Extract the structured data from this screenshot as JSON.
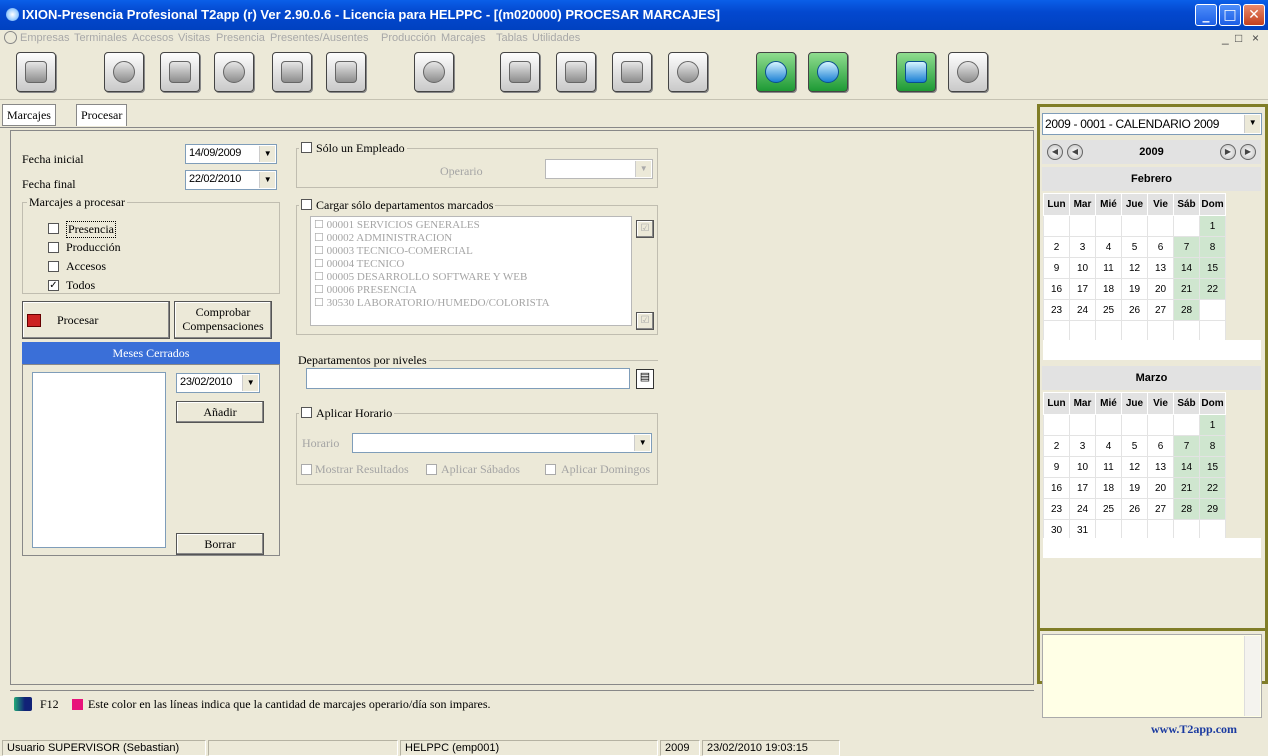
{
  "window": {
    "title": "IXION-Presencia Profesional T2app (r) Ver 2.90.0.6  -  Licencia para HELPPC - [(m020000)  PROCESAR MARCAJES]",
    "min": "_",
    "max": "□",
    "close": "✕"
  },
  "menu": {
    "items": [
      "Empresas",
      "Terminales",
      "Accesos",
      "Visitas",
      "Presencia",
      "Presentes/Ausentes",
      "Producción",
      "Marcajes",
      "Tablas",
      "Utilidades"
    ],
    "mdi_min": "_",
    "mdi_max": "□",
    "mdi_close": "×"
  },
  "toolbar": {
    "icons": [
      "users-icon",
      "disk-icon",
      "tools-icon",
      "gear-icon",
      "monitor-icon",
      "printer-icon",
      "help-icon",
      "clipboard-icon",
      "person-icon",
      "calendar-icon",
      "check-icon",
      "refresh-icon",
      "info-icon",
      "calculator-icon",
      "power-icon"
    ]
  },
  "tabs": {
    "marcajes": "Marcajes",
    "procesar": "Procesar"
  },
  "form": {
    "fecha_inicial_label": "Fecha inicial",
    "fecha_inicial": "14/09/2009",
    "fecha_final_label": "Fecha final",
    "fecha_final": "22/02/2010",
    "marcajes_group": "Marcajes a procesar",
    "presencia": "Presencia",
    "produccion": "Producción",
    "accesos": "Accesos",
    "todos": "Todos",
    "todos_checked": "✓",
    "procesar_btn": "Procesar",
    "comprobar_btn_1": "Comprobar",
    "comprobar_btn_2": "Compensaciones",
    "meses_cerrados": "Meses Cerrados",
    "mes_date": "23/02/2010",
    "anadir_btn": "Añadir",
    "borrar_btn": "Borrar",
    "solo_empleado": "Sólo un Empleado",
    "operario_label": "Operario",
    "cargar_deptos": "Cargar sólo departamentos marcados",
    "departamentos": [
      "00001 SERVICIOS GENERALES",
      "00002 ADMINISTRACION",
      "00003 TECNICO-COMERCIAL",
      "00004 TECNICO",
      "00005 DESARROLLO SOFTWARE Y WEB",
      "00006 PRESENCIA",
      "30530 LABORATORIO/HUMEDO/COLORISTA"
    ],
    "deptos_niveles": "Departamentos por niveles",
    "aplicar_horario": "Aplicar Horario",
    "horario_label": "Horario",
    "mostrar_resultados": "Mostrar Resultados",
    "aplicar_sabados": "Aplicar Sábados",
    "aplicar_domingos": "Aplicar Domingos"
  },
  "footer": {
    "f12": "F12",
    "note": "Este color en las líneas indica que la cantidad de marcajes operario/día son impares.",
    "odd_color": "#e8127a",
    "site": "www.T2app.com"
  },
  "calendar": {
    "selector": "2009 - 0001 - CALENDARIO 2009",
    "year": "2009",
    "weekdays": [
      "Lun",
      "Mar",
      "Mié",
      "Jue",
      "Vie",
      "Sáb",
      "Dom"
    ],
    "months": [
      {
        "name": "Febrero",
        "weeks": [
          [
            "",
            "",
            "",
            "",
            "",
            "",
            "1"
          ],
          [
            "2",
            "3",
            "4",
            "5",
            "6",
            "7",
            "8"
          ],
          [
            "9",
            "10",
            "11",
            "12",
            "13",
            "14",
            "15"
          ],
          [
            "16",
            "17",
            "18",
            "19",
            "20",
            "21",
            "22"
          ],
          [
            "23",
            "24",
            "25",
            "26",
            "27",
            "28",
            ""
          ],
          [
            "",
            "",
            "",
            "",
            "",
            "",
            ""
          ]
        ]
      },
      {
        "name": "Marzo",
        "weeks": [
          [
            "",
            "",
            "",
            "",
            "",
            "",
            "1"
          ],
          [
            "2",
            "3",
            "4",
            "5",
            "6",
            "7",
            "8"
          ],
          [
            "9",
            "10",
            "11",
            "12",
            "13",
            "14",
            "15"
          ],
          [
            "16",
            "17",
            "18",
            "19",
            "20",
            "21",
            "22"
          ],
          [
            "23",
            "24",
            "25",
            "26",
            "27",
            "28",
            "29"
          ],
          [
            "30",
            "31",
            "",
            "",
            "",
            "",
            ""
          ]
        ]
      }
    ],
    "weekend_color": "#cfe6cf",
    "frame_color": "#807d27"
  },
  "status": {
    "user": "Usuario SUPERVISOR (Sebastian)",
    "pc": "HELPPC  (emp001)",
    "year": "2009",
    "datetime": "23/02/2010  19:03:15"
  }
}
